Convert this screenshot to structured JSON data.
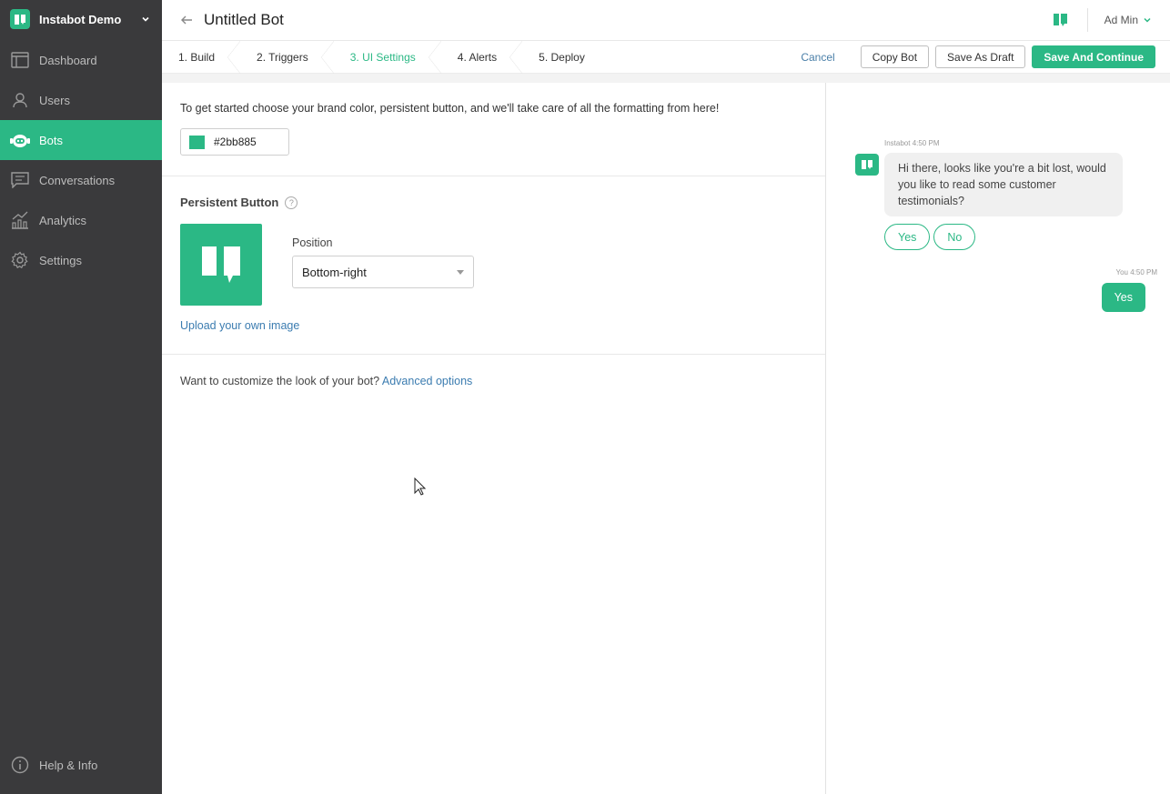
{
  "sidebar": {
    "brand": "Instabot Demo",
    "items": [
      {
        "label": "Dashboard",
        "icon": "dashboard-icon"
      },
      {
        "label": "Users",
        "icon": "user-icon"
      },
      {
        "label": "Bots",
        "icon": "bot-icon",
        "active": true
      },
      {
        "label": "Conversations",
        "icon": "chat-icon"
      },
      {
        "label": "Analytics",
        "icon": "analytics-icon"
      },
      {
        "label": "Settings",
        "icon": "gear-icon"
      }
    ],
    "help": "Help & Info"
  },
  "header": {
    "title": "Untitled Bot",
    "user": "Ad Min"
  },
  "steps": [
    "1. Build",
    "2. Triggers",
    "3. UI Settings",
    "4. Alerts",
    "5. Deploy"
  ],
  "actions": {
    "cancel": "Cancel",
    "copy": "Copy Bot",
    "draft": "Save As Draft",
    "save": "Save And Continue"
  },
  "editor": {
    "intro": "To get started choose your brand color, persistent button, and we'll take care of all the formatting from here!",
    "color_value": "#2bb885",
    "persistent_title": "Persistent Button",
    "help_mark": "?",
    "position_label": "Position",
    "position_value": "Bottom-right",
    "upload": "Upload your own image",
    "advanced_prompt": "Want to customize the look of your bot?",
    "advanced_link": "Advanced options"
  },
  "preview": {
    "bot_meta": "Instabot 4:50 PM",
    "bot_message": "Hi there, looks like you're a bit lost, would you like to read some customer testimonials?",
    "options": [
      "Yes",
      "No"
    ],
    "you_meta": "You 4:50 PM",
    "you_message": "Yes"
  },
  "colors": {
    "brand": "#2bb885",
    "sidebar_bg": "#3a3a3c",
    "link": "#3b7cb0"
  }
}
